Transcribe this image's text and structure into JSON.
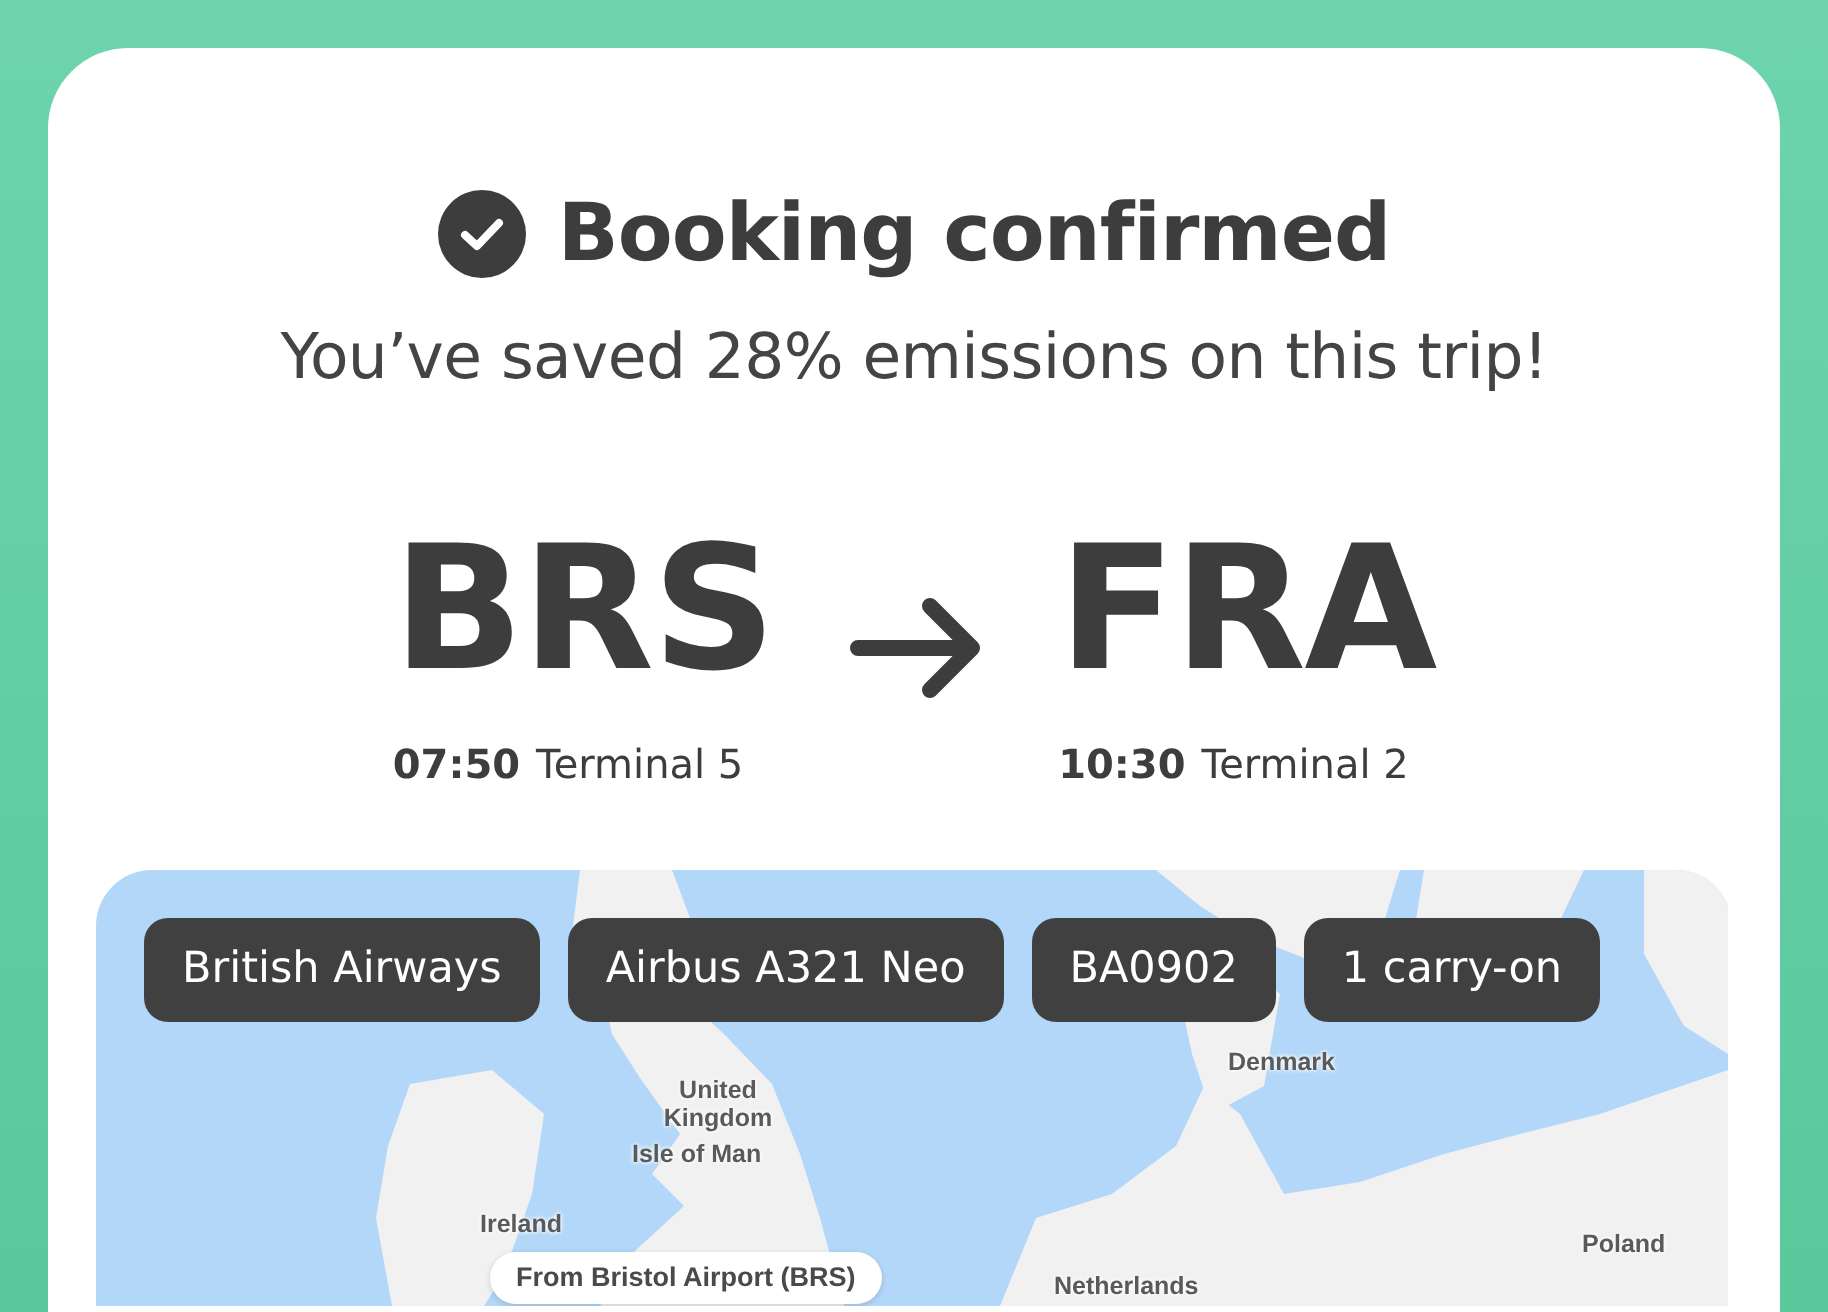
{
  "header": {
    "title": "Booking confirmed",
    "subtitle": "You’ve saved 28% emissions on this trip!"
  },
  "route": {
    "origin": {
      "code": "BRS",
      "time": "07:50",
      "terminal": "Terminal 5"
    },
    "destination": {
      "code": "FRA",
      "time": "10:30",
      "terminal": "Terminal 2"
    }
  },
  "details": [
    "British Airways",
    "Airbus A321 Neo",
    "BA0902",
    "1 carry-on"
  ],
  "map": {
    "labels": [
      "United Kingdom",
      "Isle of Man",
      "Ireland",
      "Denmark",
      "Poland",
      "Netherlands"
    ],
    "pin_label": "From Bristol Airport (BRS)"
  }
}
